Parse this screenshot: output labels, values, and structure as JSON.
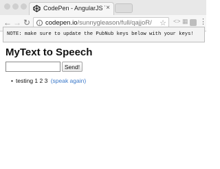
{
  "browser": {
    "tab": {
      "title": "CodePen - AngularJS Text-To-",
      "close": "×"
    },
    "nav": {
      "back": "←",
      "forward": "→",
      "reload": "↻"
    },
    "address": {
      "host": "codepen.io",
      "path": "/sunnygleason/full/qajjoR/",
      "info": "i"
    },
    "bookmark": "☆",
    "extensions": [
      "<>",
      "▦"
    ],
    "menu": "⋮"
  },
  "page": {
    "note": "NOTE: make sure to update the PubNub keys below with your keys!",
    "heading": "MyText to Speech",
    "input": {
      "value": "",
      "placeholder": ""
    },
    "send_label": "Send!",
    "messages": [
      {
        "text": "testing 1 2 3",
        "link": "(speak again)"
      }
    ]
  }
}
